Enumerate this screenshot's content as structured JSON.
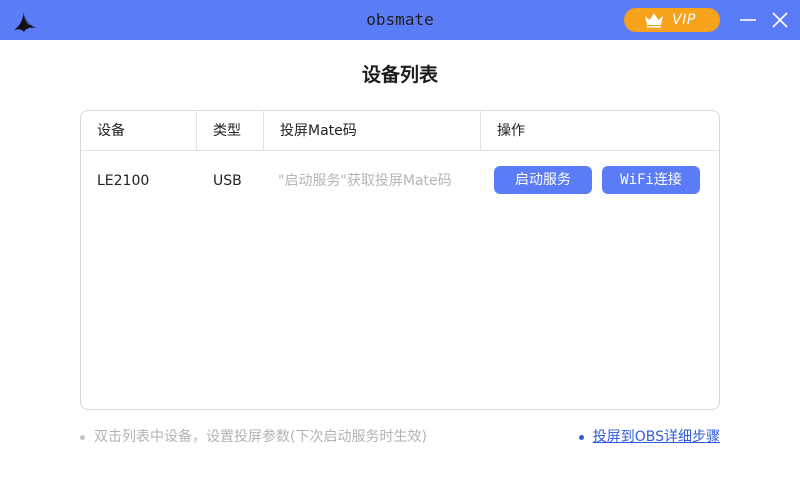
{
  "titlebar": {
    "title": "obsmate",
    "background": "#5b7cf7",
    "logo_icon": "bird-logo-icon",
    "vip": {
      "label": "VIP",
      "icon": "crown-icon",
      "color": "#f7a21b"
    },
    "controls": {
      "minimize_icon": "minimize-icon",
      "close_icon": "close-icon"
    }
  },
  "main": {
    "heading": "设备列表",
    "table": {
      "headers": [
        "设备",
        "类型",
        "投屏Mate码",
        "操作"
      ],
      "rows": [
        {
          "device": "LE2100",
          "type": "USB",
          "mate_code": "\"启动服务\"获取投屏Mate码",
          "actions": {
            "start_service": "启动服务",
            "wifi_connect": "WiFi连接"
          }
        }
      ]
    }
  },
  "footer": {
    "hint": "双击列表中设备，设置投屏参数(下次启动服务时生效)",
    "link": "投屏到OBS详细步骤"
  },
  "colors": {
    "accent": "#5b7cf7",
    "vip": "#f7a21b",
    "link": "#2f5be0",
    "placeholder_text": "#b5b5b5"
  }
}
